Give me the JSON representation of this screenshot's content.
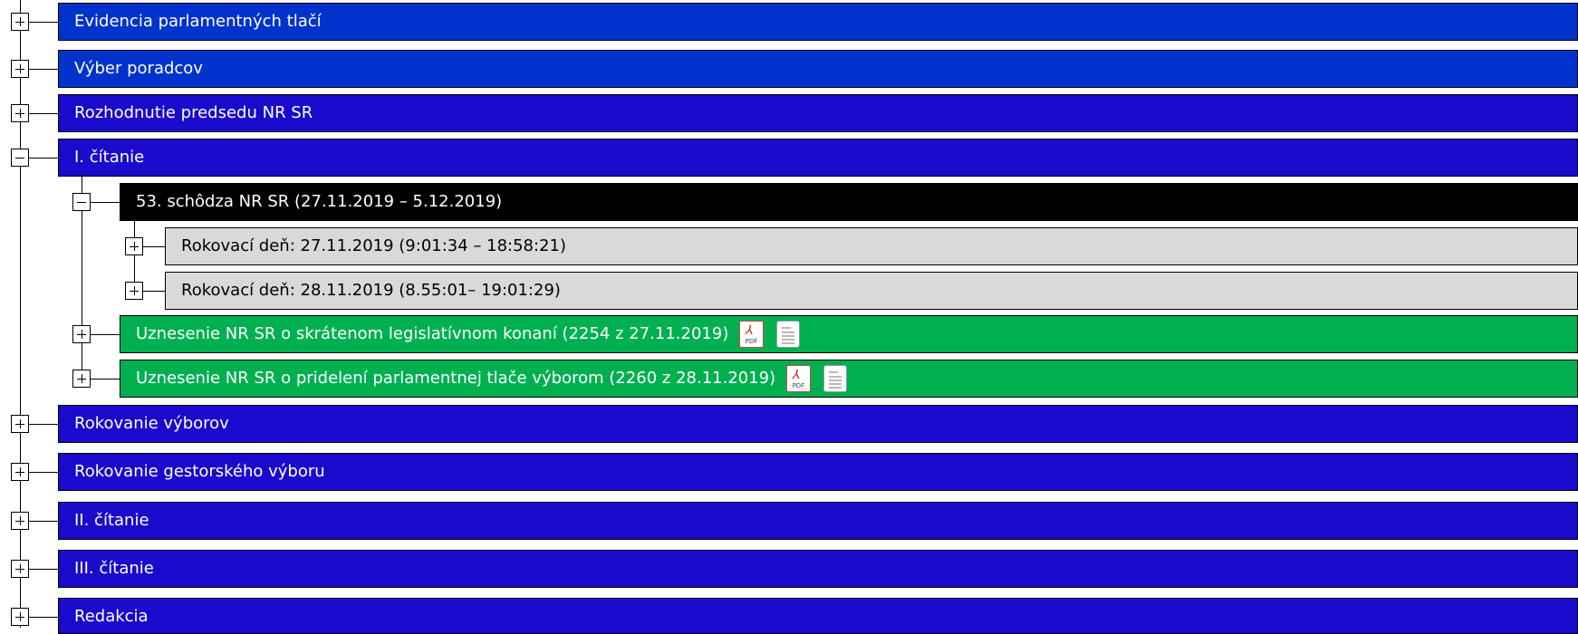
{
  "colors": {
    "level0_blue": "#0033cc",
    "level0_indigo": "#1a0acc",
    "session_black": "#000000",
    "day_gray": "#d9d9d9",
    "resolution_green": "#00b050"
  },
  "icons": {
    "expand": "plus-box-icon",
    "collapse": "minus-box-icon",
    "pdf": "pdf-file-icon",
    "doc": "document-file-icon"
  },
  "tree": {
    "evidencia": "Evidencia parlamentných tlačí",
    "vyber": "Výber poradcov",
    "rozhodnutie": "Rozhodnutie predsedu NR SR",
    "citanie1": "I. čítanie",
    "schodza": "53. schôdza NR SR (27.11.2019 – 5.12.2019)",
    "den1": "Rokovací deň: 27.11.2019 (9:01:34 – 18:58:21)",
    "den2": "Rokovací deň: 28.11.2019 (8.55:01– 19:01:29)",
    "uznesenie1": "Uznesenie NR SR o skrátenom legislatívnom konaní (2254 z 27.11.2019)",
    "uznesenie2": "Uznesenie NR SR o pridelení parlamentnej tlače výborom (2260 z 28.11.2019)",
    "rokovanie_vyborov": "Rokovanie výborov",
    "rokovanie_gestorskeho": "Rokovanie gestorského výboru",
    "citanie2": "II. čítanie",
    "citanie3": "III. čítanie",
    "redakcia": "Redakcia"
  },
  "pdf_label": "PDF"
}
